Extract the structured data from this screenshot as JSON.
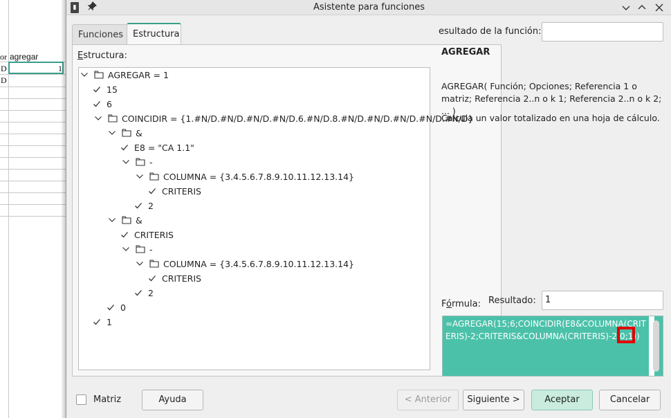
{
  "sheet": {
    "header_fragment_left": "or",
    "header_fragment_right": "agregar",
    "cell_values": [
      "D",
      "D"
    ],
    "selected_cell_value": "1"
  },
  "window": {
    "title": "Asistente para funciones",
    "icons": [
      "app-icon",
      "pin-icon",
      "chevron-down-icon",
      "chevron-up-icon",
      "close-icon"
    ]
  },
  "tabs": [
    {
      "label": "Funciones",
      "active": false
    },
    {
      "label": "Estructura",
      "active": true
    }
  ],
  "structure": {
    "label": "Estructura:",
    "label_mnemonic": "E",
    "tree": [
      {
        "text": "AGREGAR = 1",
        "type": "folder",
        "expanded": true
      },
      {
        "text": "15",
        "type": "leaf"
      },
      {
        "text": "6",
        "type": "leaf"
      },
      {
        "text": "COINCIDIR = {1.#N/D.#N/D.#N/D.#N/D.6.#N/D.8.#N/D.#N/D.#N/D.#N/D.#N/D}",
        "type": "folder",
        "expanded": true
      },
      {
        "text": "&",
        "type": "folder",
        "expanded": true
      },
      {
        "text": "E8 = \"CA 1.1\"",
        "type": "leaf"
      },
      {
        "text": "-",
        "type": "folder",
        "expanded": true
      },
      {
        "text": "COLUMNA = {3.4.5.6.7.8.9.10.11.12.13.14}",
        "type": "folder",
        "expanded": true
      },
      {
        "text": "CRITERIS",
        "type": "leaf"
      },
      {
        "text": "2",
        "type": "leaf"
      },
      {
        "text": "&",
        "type": "folder",
        "expanded": true
      },
      {
        "text": "CRITERIS",
        "type": "leaf"
      },
      {
        "text": "-",
        "type": "folder",
        "expanded": true
      },
      {
        "text": "COLUMNA = {3.4.5.6.7.8.9.10.11.12.13.14}",
        "type": "folder",
        "expanded": true
      },
      {
        "text": "CRITERIS",
        "type": "leaf"
      },
      {
        "text": "2",
        "type": "leaf"
      },
      {
        "text": "0",
        "type": "leaf"
      },
      {
        "text": "1",
        "type": "leaf"
      }
    ]
  },
  "function_info": {
    "result_label": "esultado de la función:",
    "result_value": "",
    "name": "AGREGAR",
    "syntax": "AGREGAR( Función; Opciones; Referencia 1 o matriz; Referencia 2..n o k 1; Referencia 2..n o k 2; ...  )",
    "description": "Calcula un valor totalizado en una hoja de cálculo."
  },
  "formula": {
    "label": "Fórmula:",
    "label_mnemonic": "ó",
    "resultado_label": "Resultado:",
    "resultado_value": "1",
    "text": "=AGREGAR(15;6;COINCIDIR(E8&COLUMNA(CRITERIS)-2;CRITERIS&COLUMNA(CRITERIS)-2;0;1))"
  },
  "buttons": {
    "matriz": "Matriz",
    "ayuda": "Ayuda",
    "anterior": "< Anterior",
    "siguiente": "Siguiente >",
    "aceptar": "Aceptar",
    "cancelar": "Cancelar"
  },
  "colors": {
    "accent": "#3a9e8a",
    "formula_selection": "#4cc1aa",
    "highlight_box": "#e00000",
    "default_button": "#c9ecdf"
  }
}
